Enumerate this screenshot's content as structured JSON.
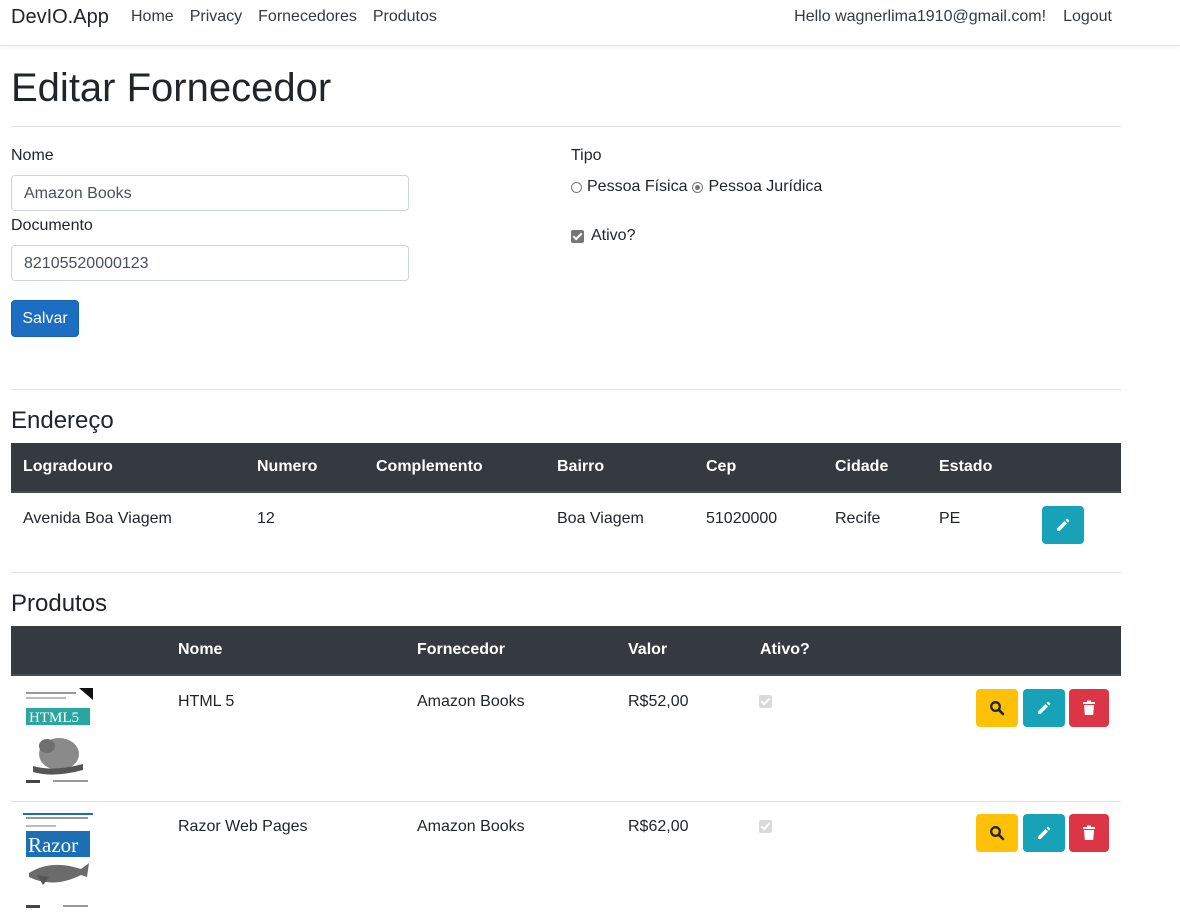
{
  "navbar": {
    "brand": "DevIO.App",
    "links": [
      "Home",
      "Privacy",
      "Fornecedores",
      "Produtos"
    ],
    "hello": "Hello wagnerlima1910@gmail.com!",
    "logout": "Logout"
  },
  "page": {
    "title": "Editar Fornecedor"
  },
  "form": {
    "nome_label": "Nome",
    "nome_value": "Amazon Books",
    "documento_label": "Documento",
    "documento_value": "82105520000123",
    "tipo_label": "Tipo",
    "radio_fisica": "Pessoa Física",
    "radio_juridica": "Pessoa Jurídica",
    "tipo_selected": "Pessoa Jurídica",
    "ativo_label": "Ativo?",
    "ativo_checked": true,
    "save_label": "Salvar"
  },
  "endereco": {
    "title": "Endereço",
    "headers": [
      "Logradouro",
      "Numero",
      "Complemento",
      "Bairro",
      "Cep",
      "Cidade",
      "Estado"
    ],
    "row": {
      "logradouro": "Avenida Boa Viagem",
      "numero": "12",
      "complemento": "",
      "bairro": "Boa Viagem",
      "cep": "51020000",
      "cidade": "Recife",
      "estado": "PE"
    }
  },
  "produtos": {
    "title": "Produtos",
    "headers": [
      "Nome",
      "Fornecedor",
      "Valor",
      "Ativo?"
    ],
    "rows": [
      {
        "nome": "HTML 5",
        "fornecedor": "Amazon Books",
        "valor": "R$52,00",
        "ativo": true,
        "cover_text": "HTML5"
      },
      {
        "nome": "Razor Web Pages",
        "fornecedor": "Amazon Books",
        "valor": "R$62,00",
        "ativo": true,
        "cover_text": "Razor"
      }
    ]
  },
  "colors": {
    "primary": "#1b6ec2",
    "info": "#17a2b8",
    "warning": "#ffc107",
    "danger": "#dc3545",
    "table_head": "#343a40"
  }
}
